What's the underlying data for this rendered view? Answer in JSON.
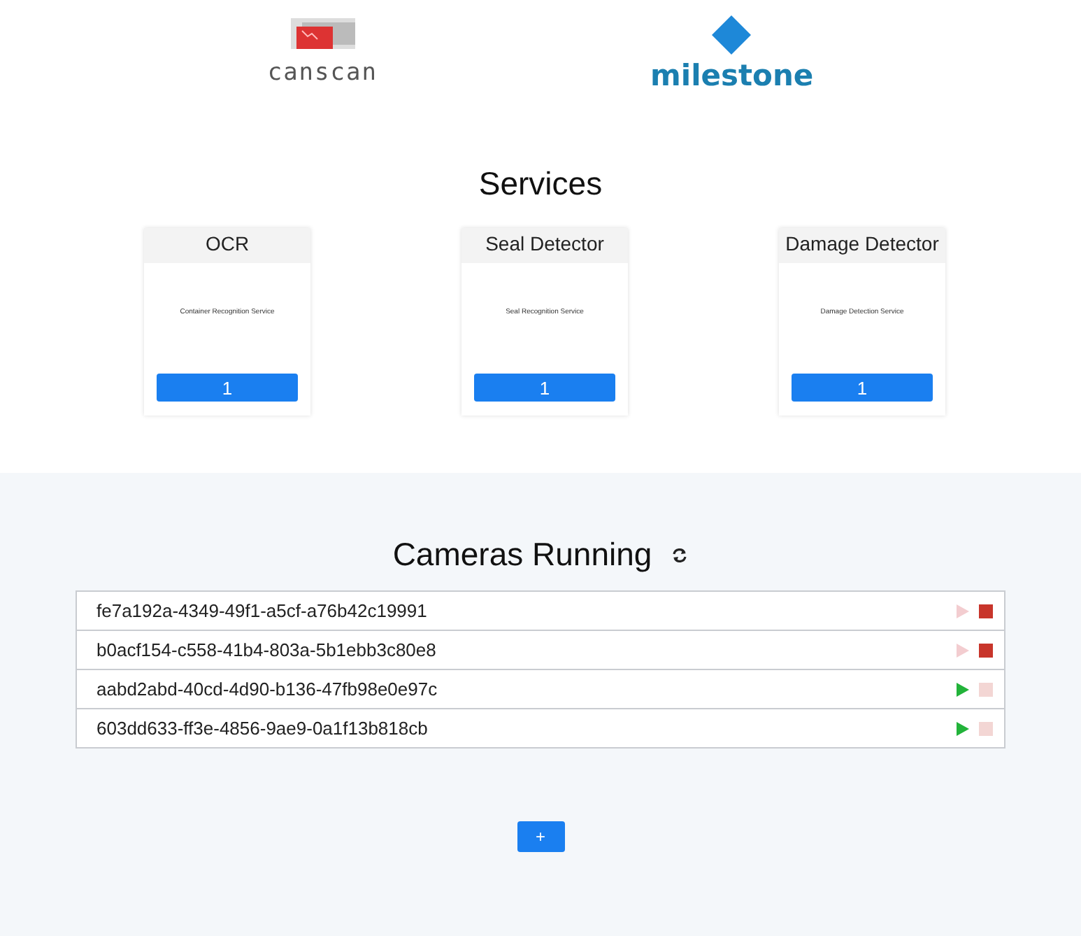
{
  "logos": [
    {
      "kind": "canscan",
      "text": "canscan"
    },
    {
      "kind": "milestone",
      "text": "milestone"
    }
  ],
  "services": {
    "title": "Services",
    "cards": [
      {
        "name": "OCR",
        "description": "Container Recognition Service",
        "count": "1"
      },
      {
        "name": "Seal Detector",
        "description": "Seal Recognition Service",
        "count": "1"
      },
      {
        "name": "Damage Detector",
        "description": "Damage Detection Service",
        "count": "1"
      }
    ]
  },
  "cameras": {
    "title": "Cameras Running",
    "rows": [
      {
        "id": "fe7a192a-4349-49f1-a5cf-a76b42c19991",
        "running": true
      },
      {
        "id": "b0acf154-c558-41b4-803a-5b1ebb3c80e8",
        "running": true
      },
      {
        "id": "aabd2abd-40cd-4d90-b136-47fb98e0e97c",
        "running": false
      },
      {
        "id": "603dd633-ff3e-4856-9ae9-0a1f13b818cb",
        "running": false
      }
    ],
    "add_button": "+"
  }
}
